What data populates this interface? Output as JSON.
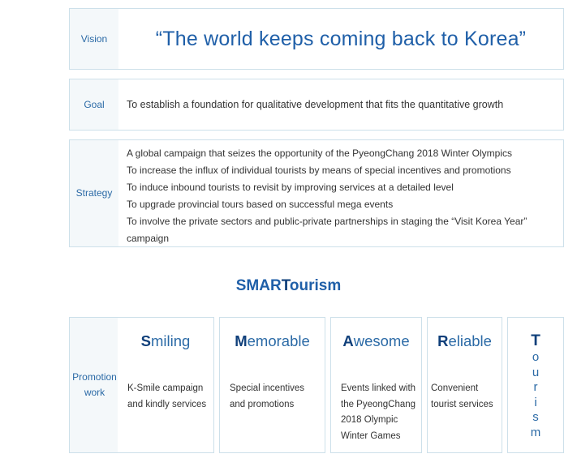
{
  "vision": {
    "label": "Vision",
    "text": "“The world keeps coming back to Korea”"
  },
  "goal": {
    "label": "Goal",
    "text": "To establish a foundation for qualitative development that fits the quantitative growth"
  },
  "strategy": {
    "label": "Strategy",
    "items": [
      "A global campaign that seizes the opportunity of the PyeongChang 2018 Winter Olympics",
      "To increase the influx of individual tourists by means of special incentives and promotions",
      "To induce inbound tourists to revisit by improving services at a detailed level",
      "To upgrade provincial tours based on successful mega events",
      "To involve the private sectors and public-private partnerships in staging the “Visit Korea Year” campaign"
    ]
  },
  "smart": {
    "title_a": "SMAR",
    "title_b": "T",
    "title_c": "ourism"
  },
  "promotion": {
    "label_line1": "Promotion",
    "label_line2": "work",
    "cards": [
      {
        "cap": "S",
        "rest": "miling",
        "desc": "K-Smile campaign and kindly services"
      },
      {
        "cap": "M",
        "rest": "emorable",
        "desc": "Special incentives and promotions"
      },
      {
        "cap": "A",
        "rest": "wesome",
        "desc": "Events linked with the PyeongChang 2018 Olympic Winter Games"
      },
      {
        "cap": "R",
        "rest": "eliable",
        "desc": "Convenient tourist services"
      }
    ],
    "tourism": {
      "cap": "T",
      "letters": [
        "o",
        "u",
        "r",
        "i",
        "s",
        "m"
      ]
    }
  },
  "colors": {
    "accent": "#1f5fa8",
    "dark_accent": "#0f3f7a",
    "border": "#cde0ea",
    "label_bg": "#f4f8fa"
  }
}
